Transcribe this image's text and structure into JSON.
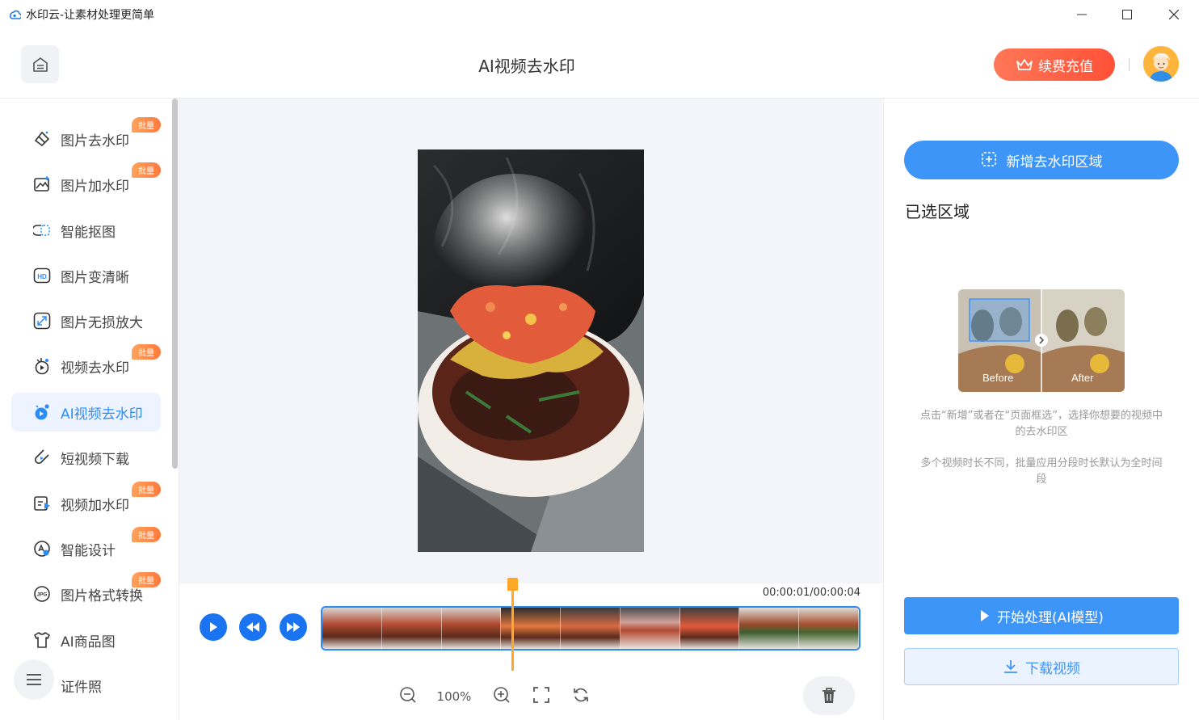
{
  "window": {
    "title": "水印云-让素材处理更简单"
  },
  "header": {
    "page_title": "AI视频去水印",
    "renew_label": "续费充值"
  },
  "sidebar": {
    "items": [
      {
        "label": "图片去水印",
        "icon": "eraser-icon",
        "badge": "批量"
      },
      {
        "label": "图片加水印",
        "icon": "image-add-icon",
        "badge": "批量"
      },
      {
        "label": "智能抠图",
        "icon": "cutout-icon",
        "badge": ""
      },
      {
        "label": "图片变清晰",
        "icon": "hd-icon",
        "badge": ""
      },
      {
        "label": "图片无损放大",
        "icon": "enlarge-icon",
        "badge": ""
      },
      {
        "label": "视频去水印",
        "icon": "video-eraser-icon",
        "badge": "批量"
      },
      {
        "label": "AI视频去水印",
        "icon": "ai-video-icon",
        "badge": ""
      },
      {
        "label": "短视频下载",
        "icon": "short-video-icon",
        "badge": ""
      },
      {
        "label": "视频加水印",
        "icon": "video-add-icon",
        "badge": "批量"
      },
      {
        "label": "智能设计",
        "icon": "design-icon",
        "badge": "批量"
      },
      {
        "label": "图片格式转换",
        "icon": "jpg-icon",
        "badge": "批量"
      },
      {
        "label": "AI商品图",
        "icon": "shirt-icon",
        "badge": ""
      },
      {
        "label": "证件照",
        "icon": "id-photo-icon",
        "badge": ""
      }
    ],
    "active": "AI视频去水印"
  },
  "player": {
    "time": "00:00:01/00:00:04",
    "zoom": "100%",
    "progress": 0.25
  },
  "right_panel": {
    "add_area_label": "新增去水印区域",
    "selected_title": "已选区域",
    "before_label": "Before",
    "after_label": "After",
    "tip1": "点击“新增”或者在“页面框选”，选择你想要的视频中的去水印区",
    "tip2": "多个视频时长不同，批量应用分段时长默认为全时间段",
    "start_label": "开始处理(AI模型)",
    "download_label": "下载视频"
  },
  "colors": {
    "accent": "#3d95f8",
    "renew": "#ff5a3e",
    "badge": "#ff8a45",
    "playhead": "#ffa726"
  }
}
